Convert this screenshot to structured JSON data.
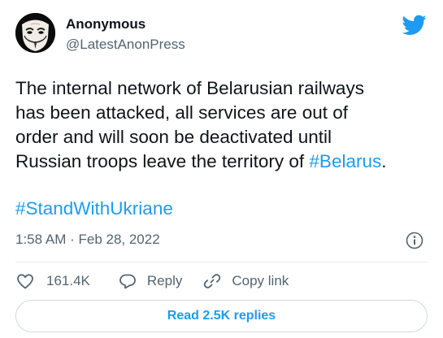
{
  "tweet": {
    "author": {
      "name": "Anonymous",
      "handle": "@LatestAnonPress",
      "avatar_icon": "guy-fawkes-mask-avatar"
    },
    "platform_icon": "twitter-bird-icon",
    "text_lines": [
      "The internal network of Belarusian railways",
      "has been attacked, all services are out of",
      "order and will soon be deactivated until",
      "Russian troops leave the territory of "
    ],
    "inline_hashtag": "#Belarus",
    "trailing_punct": ".",
    "hashtag_line": "#StandWithUkriane",
    "timestamp": "1:58 AM · Feb 28, 2022",
    "actions": {
      "like_count": "161.4K",
      "reply_label": "Reply",
      "copy_label": "Copy link"
    },
    "read_replies_label": "Read 2.5K replies",
    "colors": {
      "accent": "#1d9bf0",
      "text": "#0f1419",
      "muted": "#536471",
      "border": "#cfd9de"
    }
  }
}
